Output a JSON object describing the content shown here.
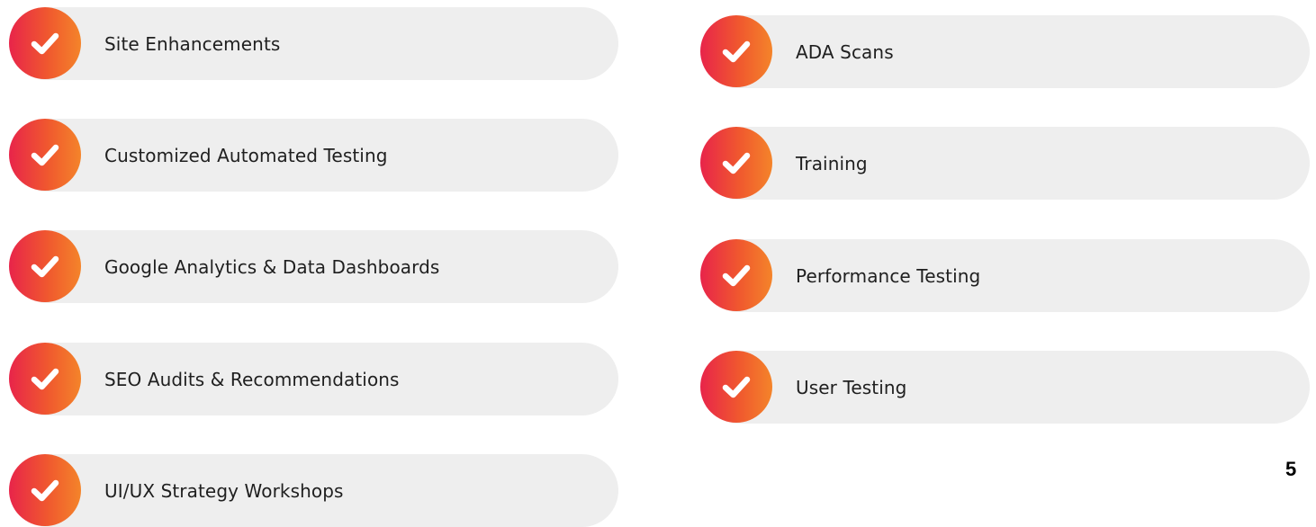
{
  "page_number": "5",
  "accent": {
    "gradient_start": "#e8244a",
    "gradient_end": "#f4842a",
    "pill_background": "#eeeeee"
  },
  "icon": "check-circle-icon",
  "left_column": [
    {
      "label": "Site Enhancements"
    },
    {
      "label": "Customized Automated Testing"
    },
    {
      "label": "Google Analytics & Data Dashboards"
    },
    {
      "label": "SEO Audits & Recommendations"
    },
    {
      "label": "UI/UX Strategy Workshops"
    }
  ],
  "right_column": [
    {
      "label": "ADA Scans"
    },
    {
      "label": "Training"
    },
    {
      "label": "Performance Testing"
    },
    {
      "label": "User Testing"
    }
  ]
}
